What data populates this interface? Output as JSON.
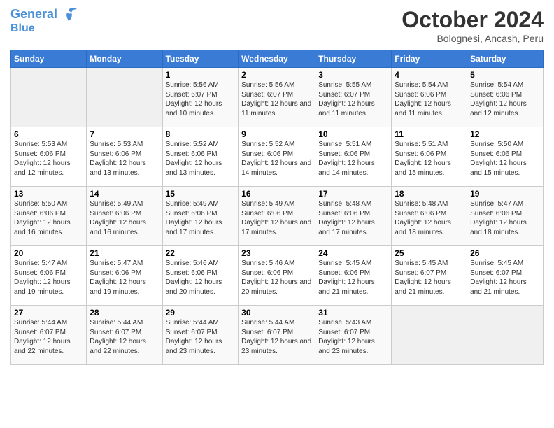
{
  "header": {
    "logo_line1": "General",
    "logo_line2": "Blue",
    "month": "October 2024",
    "location": "Bolognesi, Ancash, Peru"
  },
  "weekdays": [
    "Sunday",
    "Monday",
    "Tuesday",
    "Wednesday",
    "Thursday",
    "Friday",
    "Saturday"
  ],
  "weeks": [
    [
      {
        "day": "",
        "empty": true
      },
      {
        "day": "",
        "empty": true
      },
      {
        "day": "1",
        "sunrise": "Sunrise: 5:56 AM",
        "sunset": "Sunset: 6:07 PM",
        "daylight": "Daylight: 12 hours and 10 minutes."
      },
      {
        "day": "2",
        "sunrise": "Sunrise: 5:56 AM",
        "sunset": "Sunset: 6:07 PM",
        "daylight": "Daylight: 12 hours and 11 minutes."
      },
      {
        "day": "3",
        "sunrise": "Sunrise: 5:55 AM",
        "sunset": "Sunset: 6:07 PM",
        "daylight": "Daylight: 12 hours and 11 minutes."
      },
      {
        "day": "4",
        "sunrise": "Sunrise: 5:54 AM",
        "sunset": "Sunset: 6:06 PM",
        "daylight": "Daylight: 12 hours and 11 minutes."
      },
      {
        "day": "5",
        "sunrise": "Sunrise: 5:54 AM",
        "sunset": "Sunset: 6:06 PM",
        "daylight": "Daylight: 12 hours and 12 minutes."
      }
    ],
    [
      {
        "day": "6",
        "sunrise": "Sunrise: 5:53 AM",
        "sunset": "Sunset: 6:06 PM",
        "daylight": "Daylight: 12 hours and 12 minutes."
      },
      {
        "day": "7",
        "sunrise": "Sunrise: 5:53 AM",
        "sunset": "Sunset: 6:06 PM",
        "daylight": "Daylight: 12 hours and 13 minutes."
      },
      {
        "day": "8",
        "sunrise": "Sunrise: 5:52 AM",
        "sunset": "Sunset: 6:06 PM",
        "daylight": "Daylight: 12 hours and 13 minutes."
      },
      {
        "day": "9",
        "sunrise": "Sunrise: 5:52 AM",
        "sunset": "Sunset: 6:06 PM",
        "daylight": "Daylight: 12 hours and 14 minutes."
      },
      {
        "day": "10",
        "sunrise": "Sunrise: 5:51 AM",
        "sunset": "Sunset: 6:06 PM",
        "daylight": "Daylight: 12 hours and 14 minutes."
      },
      {
        "day": "11",
        "sunrise": "Sunrise: 5:51 AM",
        "sunset": "Sunset: 6:06 PM",
        "daylight": "Daylight: 12 hours and 15 minutes."
      },
      {
        "day": "12",
        "sunrise": "Sunrise: 5:50 AM",
        "sunset": "Sunset: 6:06 PM",
        "daylight": "Daylight: 12 hours and 15 minutes."
      }
    ],
    [
      {
        "day": "13",
        "sunrise": "Sunrise: 5:50 AM",
        "sunset": "Sunset: 6:06 PM",
        "daylight": "Daylight: 12 hours and 16 minutes."
      },
      {
        "day": "14",
        "sunrise": "Sunrise: 5:49 AM",
        "sunset": "Sunset: 6:06 PM",
        "daylight": "Daylight: 12 hours and 16 minutes."
      },
      {
        "day": "15",
        "sunrise": "Sunrise: 5:49 AM",
        "sunset": "Sunset: 6:06 PM",
        "daylight": "Daylight: 12 hours and 17 minutes."
      },
      {
        "day": "16",
        "sunrise": "Sunrise: 5:49 AM",
        "sunset": "Sunset: 6:06 PM",
        "daylight": "Daylight: 12 hours and 17 minutes."
      },
      {
        "day": "17",
        "sunrise": "Sunrise: 5:48 AM",
        "sunset": "Sunset: 6:06 PM",
        "daylight": "Daylight: 12 hours and 17 minutes."
      },
      {
        "day": "18",
        "sunrise": "Sunrise: 5:48 AM",
        "sunset": "Sunset: 6:06 PM",
        "daylight": "Daylight: 12 hours and 18 minutes."
      },
      {
        "day": "19",
        "sunrise": "Sunrise: 5:47 AM",
        "sunset": "Sunset: 6:06 PM",
        "daylight": "Daylight: 12 hours and 18 minutes."
      }
    ],
    [
      {
        "day": "20",
        "sunrise": "Sunrise: 5:47 AM",
        "sunset": "Sunset: 6:06 PM",
        "daylight": "Daylight: 12 hours and 19 minutes."
      },
      {
        "day": "21",
        "sunrise": "Sunrise: 5:47 AM",
        "sunset": "Sunset: 6:06 PM",
        "daylight": "Daylight: 12 hours and 19 minutes."
      },
      {
        "day": "22",
        "sunrise": "Sunrise: 5:46 AM",
        "sunset": "Sunset: 6:06 PM",
        "daylight": "Daylight: 12 hours and 20 minutes."
      },
      {
        "day": "23",
        "sunrise": "Sunrise: 5:46 AM",
        "sunset": "Sunset: 6:06 PM",
        "daylight": "Daylight: 12 hours and 20 minutes."
      },
      {
        "day": "24",
        "sunrise": "Sunrise: 5:45 AM",
        "sunset": "Sunset: 6:06 PM",
        "daylight": "Daylight: 12 hours and 21 minutes."
      },
      {
        "day": "25",
        "sunrise": "Sunrise: 5:45 AM",
        "sunset": "Sunset: 6:07 PM",
        "daylight": "Daylight: 12 hours and 21 minutes."
      },
      {
        "day": "26",
        "sunrise": "Sunrise: 5:45 AM",
        "sunset": "Sunset: 6:07 PM",
        "daylight": "Daylight: 12 hours and 21 minutes."
      }
    ],
    [
      {
        "day": "27",
        "sunrise": "Sunrise: 5:44 AM",
        "sunset": "Sunset: 6:07 PM",
        "daylight": "Daylight: 12 hours and 22 minutes."
      },
      {
        "day": "28",
        "sunrise": "Sunrise: 5:44 AM",
        "sunset": "Sunset: 6:07 PM",
        "daylight": "Daylight: 12 hours and 22 minutes."
      },
      {
        "day": "29",
        "sunrise": "Sunrise: 5:44 AM",
        "sunset": "Sunset: 6:07 PM",
        "daylight": "Daylight: 12 hours and 23 minutes."
      },
      {
        "day": "30",
        "sunrise": "Sunrise: 5:44 AM",
        "sunset": "Sunset: 6:07 PM",
        "daylight": "Daylight: 12 hours and 23 minutes."
      },
      {
        "day": "31",
        "sunrise": "Sunrise: 5:43 AM",
        "sunset": "Sunset: 6:07 PM",
        "daylight": "Daylight: 12 hours and 23 minutes."
      },
      {
        "day": "",
        "empty": true
      },
      {
        "day": "",
        "empty": true
      }
    ]
  ]
}
